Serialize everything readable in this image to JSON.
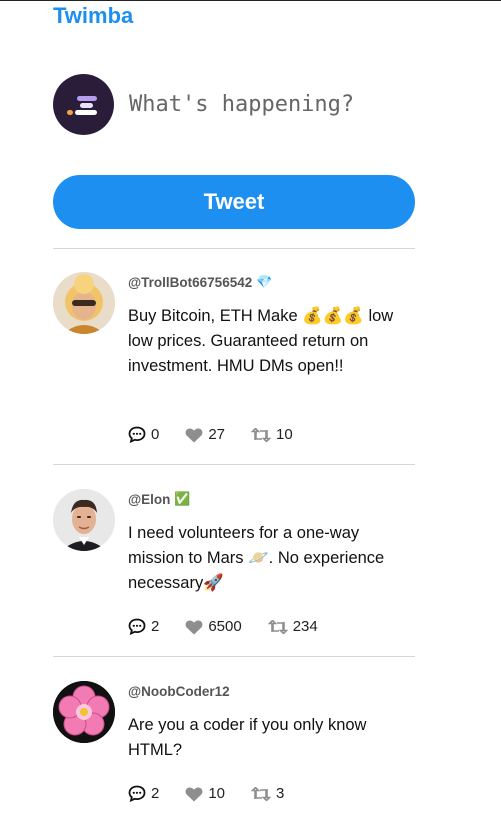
{
  "app": {
    "name": "Twimba"
  },
  "compose": {
    "placeholder": "What's happening?",
    "button_label": "Tweet"
  },
  "tweets": [
    {
      "handle": "@TrollBot66756542",
      "badge": "💎",
      "text": "Buy Bitcoin, ETH Make 💰💰💰 low low prices. Guaranteed return on investment. HMU DMs open!!",
      "replies": "0",
      "likes": "27",
      "retweets": "10"
    },
    {
      "handle": "@Elon",
      "badge": "✅",
      "text": "I need volunteers for a one-way mission to Mars 🪐. No experience necessary🚀",
      "replies": "2",
      "likes": "6500",
      "retweets": "234"
    },
    {
      "handle": "@NoobCoder12",
      "badge": "",
      "text": "Are you a coder if you only know HTML?",
      "replies": "2",
      "likes": "10",
      "retweets": "3"
    }
  ],
  "colors": {
    "brand": "#1d8ff0",
    "divider": "#d6d6d6"
  },
  "icons": {
    "reply": "comment-dots-icon",
    "like": "heart-icon",
    "retweet": "retweet-icon"
  }
}
